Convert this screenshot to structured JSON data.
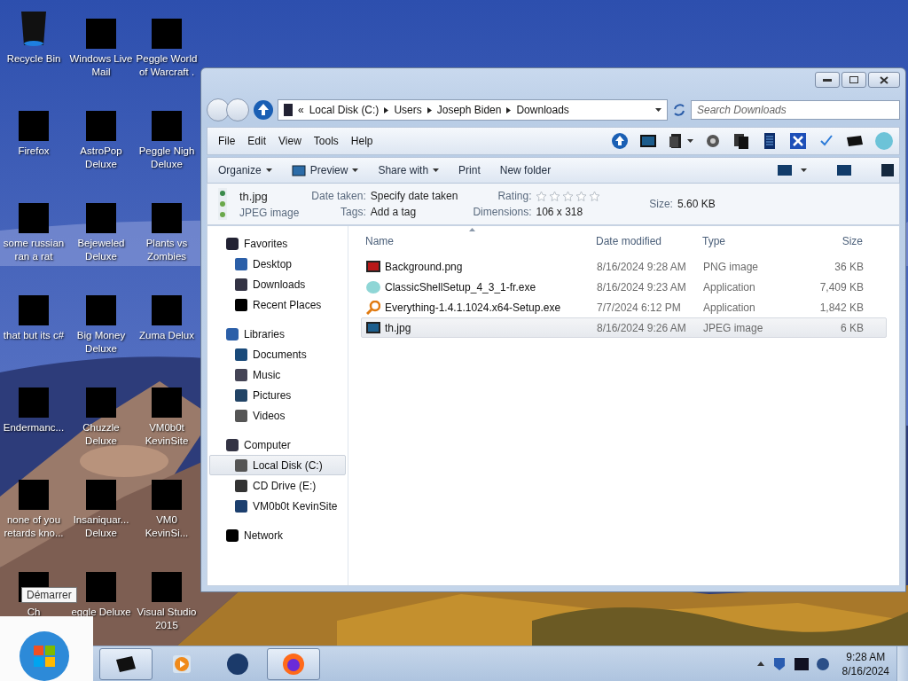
{
  "desktop_icons": [
    {
      "label": "Recycle Bin",
      "redacted": false
    },
    {
      "label": "Firefox",
      "redacted": true
    },
    {
      "label": "some russian ran a rat",
      "redacted": true
    },
    {
      "label": "that but its c#",
      "redacted": true
    },
    {
      "label": "Endermanc...",
      "redacted": true
    },
    {
      "label": "none of you retards kno...",
      "redacted": true
    },
    {
      "label": "Ch",
      "redacted": true
    },
    {
      "label": "Windows Live Mail",
      "redacted": true
    },
    {
      "label": "AstroPop Deluxe",
      "redacted": true
    },
    {
      "label": "Bejeweled Deluxe",
      "redacted": true
    },
    {
      "label": "Big Money Deluxe",
      "redacted": true
    },
    {
      "label": "Chuzzle Deluxe",
      "redacted": true
    },
    {
      "label": "Insaniquar... Deluxe",
      "redacted": true
    },
    {
      "label": "eggle Deluxe",
      "redacted": true
    },
    {
      "label": "Peggle World of Warcraft .",
      "redacted": true
    },
    {
      "label": "Peggle Nigh Deluxe",
      "redacted": true
    },
    {
      "label": "Plants vs Zombies",
      "redacted": true
    },
    {
      "label": "Zuma Delux",
      "redacted": true
    },
    {
      "label": "VM0b0t KevinSite",
      "redacted": true
    },
    {
      "label": "VM0 KevinSi...",
      "redacted": true
    },
    {
      "label": "Visual Studio 2015",
      "redacted": true
    }
  ],
  "tooltip": "Démarrer",
  "explorer": {
    "address": [
      "«",
      "Local Disk (C:)",
      "Users",
      "Joseph Biden",
      "Downloads"
    ],
    "search": {
      "placeholder": "Search Downloads"
    },
    "menu": [
      "File",
      "Edit",
      "View",
      "Tools",
      "Help"
    ],
    "commands": [
      {
        "label": "Organize",
        "dropdown": true,
        "has_icon": false
      },
      {
        "label": "Preview",
        "dropdown": true,
        "has_icon": true
      },
      {
        "label": "Share with",
        "dropdown": true,
        "has_icon": false
      },
      {
        "label": "Print",
        "dropdown": false,
        "has_icon": false
      },
      {
        "label": "New folder",
        "dropdown": false,
        "has_icon": false
      }
    ],
    "details": {
      "name": "th.jpg",
      "type": "JPEG image",
      "columns": [
        [
          {
            "label": "Date taken:",
            "value": "Specify date taken"
          },
          {
            "label": "Tags:",
            "value": "Add a tag"
          }
        ],
        [
          {
            "label": "Rating:",
            "stars": 0
          },
          {
            "label": "Dimensions:",
            "value": "106 x 318"
          }
        ],
        [
          {
            "label": "Size:",
            "value": "5.60 KB"
          }
        ]
      ]
    },
    "nav": [
      {
        "label": "Favorites",
        "selected": false,
        "children": [
          {
            "label": "Desktop",
            "selected": false
          },
          {
            "label": "Downloads",
            "selected": false
          },
          {
            "label": "Recent Places",
            "selected": false
          }
        ]
      },
      {
        "label": "Libraries",
        "selected": false,
        "children": [
          {
            "label": "Documents",
            "selected": false
          },
          {
            "label": "Music",
            "selected": false
          },
          {
            "label": "Pictures",
            "selected": false
          },
          {
            "label": "Videos",
            "selected": false
          }
        ]
      },
      {
        "label": "Computer",
        "selected": false,
        "children": [
          {
            "label": "Local Disk (C:)",
            "selected": true
          },
          {
            "label": "CD Drive (E:)",
            "selected": false
          },
          {
            "label": "VM0b0t KevinSite",
            "selected": false
          }
        ]
      },
      {
        "label": "Network",
        "selected": false
      }
    ],
    "columns": [
      "Name",
      "Date modified",
      "Type",
      "Size"
    ],
    "files": [
      {
        "name": "Background.png",
        "date": "8/16/2024 9:28 AM",
        "type": "PNG image",
        "size": "36 KB",
        "selected": false
      },
      {
        "name": "ClassicShellSetup_4_3_1-fr.exe",
        "date": "8/16/2024 9:23 AM",
        "type": "Application",
        "size": "7,409 KB",
        "selected": false
      },
      {
        "name": "Everything-1.4.1.1024.x64-Setup.exe",
        "date": "7/7/2024 6:12 PM",
        "type": "Application",
        "size": "1,842 KB",
        "selected": false
      },
      {
        "name": "th.jpg",
        "date": "8/16/2024 9:26 AM",
        "type": "JPEG image",
        "size": "6 KB",
        "selected": true
      }
    ]
  },
  "taskbar": {
    "buttons": [
      {
        "active": true
      },
      {
        "active": false
      },
      {
        "active": false
      },
      {
        "active": true
      }
    ],
    "time": "9:28 AM",
    "date": "8/16/2024"
  }
}
